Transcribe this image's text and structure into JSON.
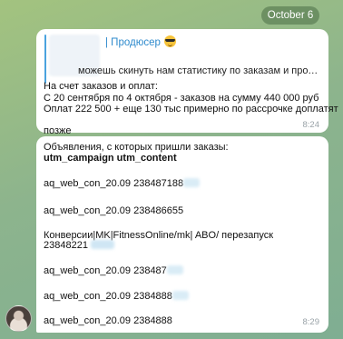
{
  "date_chip": "October 6",
  "message1": {
    "reply": {
      "author": "| Продюсер",
      "emoji": "sunglasses-emoji",
      "text": "можешь скинуть нам статистику по заказам и продаж..."
    },
    "lines": [
      "На счет заказов и оплат:",
      "С 20 сентября по 4 октября - заказов на сумму 440 000 руб",
      "Оплат 222 500 + еще 130 тыс примерно по рассрочке доплатят",
      "позже"
    ],
    "time": "8:24"
  },
  "message2": {
    "title": "Объявления, с которых пришли заказы:",
    "header": "utm_campaign  utm_content",
    "rows": [
      "aq_web_con_20.09  238487188",
      "aq_web_con_20.09  238486655",
      "Конверсии|MK|FitnessOnline/mk| ABO/ перезапуск",
      "23848221",
      "aq_web_con_20.09  238487",
      "aq_web_con_20.09  2384888",
      "aq_web_con_20.09  2384888"
    ],
    "time": "8:29"
  },
  "colors": {
    "accent": "#2f8bcd",
    "bubble": "#ffffff",
    "date_chip": "#4a6e46"
  }
}
